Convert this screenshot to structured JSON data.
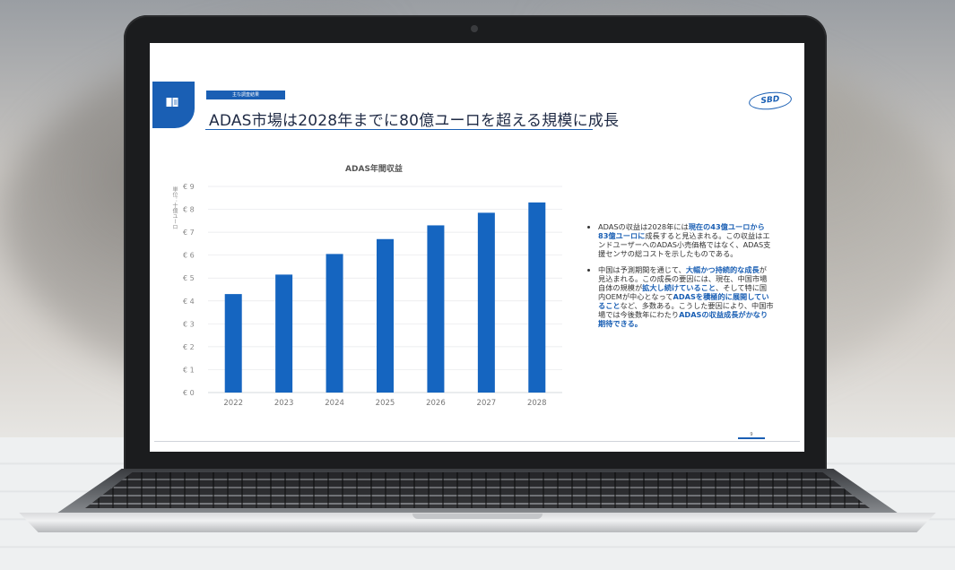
{
  "slide": {
    "tag": "主な調査結果",
    "title": "ADAS市場は2028年までに80億ユーロを超える規模に成長",
    "logo": "SBD",
    "page_number": "9",
    "accent_color": "#1a5fb4"
  },
  "notes": [
    {
      "parts": [
        {
          "text": "ADASの収益は2028年には",
          "bold": false
        },
        {
          "text": "現在の43億ユーロから83億ユーロに",
          "bold": true
        },
        {
          "text": "成長すると見込まれる。この収益はエンドユーザーへのADAS小売価格ではなく、ADAS支援センサの総コストを示したものである。",
          "bold": false
        }
      ]
    },
    {
      "parts": [
        {
          "text": "中国は予測期間を通じて、",
          "bold": false
        },
        {
          "text": "大幅かつ持続的な成長",
          "bold": true
        },
        {
          "text": "が見込まれる。この成長の要因には、現在、中国市場自体の規模が",
          "bold": false
        },
        {
          "text": "拡大し続けていること",
          "bold": true
        },
        {
          "text": "、そして特に国内OEMが中心となって",
          "bold": false
        },
        {
          "text": "ADASを積極的に展開していること",
          "bold": true
        },
        {
          "text": "など、多数ある。こうした要因により、中国市場では今後数年にわたり",
          "bold": false
        },
        {
          "text": "ADASの収益成長がかなり期待できる。",
          "bold": true
        }
      ]
    }
  ],
  "chart_data": {
    "type": "bar",
    "title": "ADAS年間収益",
    "ylabel": "単位：十億ユーロ",
    "categories": [
      "2022",
      "2023",
      "2024",
      "2025",
      "2026",
      "2027",
      "2028"
    ],
    "values": [
      4.3,
      5.15,
      6.05,
      6.7,
      7.3,
      7.85,
      8.3
    ],
    "ylim": [
      0,
      9
    ],
    "yticks": [
      "€ 0",
      "€ 1",
      "€ 2",
      "€ 3",
      "€ 4",
      "€ 5",
      "€ 6",
      "€ 7",
      "€ 8",
      "€ 9"
    ],
    "bar_color": "#1565c0",
    "grid": true,
    "legend": "none"
  }
}
